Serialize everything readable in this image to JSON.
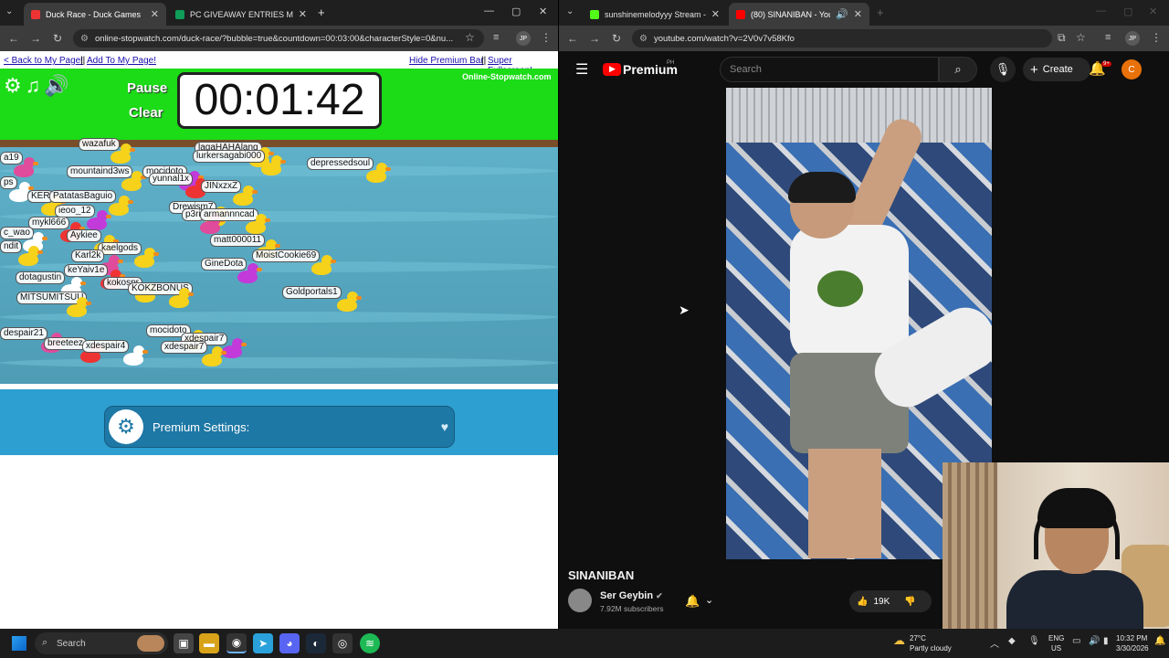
{
  "left_browser": {
    "tabs": [
      {
        "title": "Duck Race - Duck Games",
        "active": true
      },
      {
        "title": "PC GIVEAWAY ENTRIES MAY 20",
        "active": false
      }
    ],
    "url": "online-stopwatch.com/duck-race/?bubble=true&countdown=00:03:00&characterStyle=0&nu...",
    "avatar_initials": "JP"
  },
  "duck_page": {
    "links": {
      "back": "< Back to My Page!",
      "separator": "||",
      "add": "Add To My Page!",
      "hide_premium": "Hide Premium Bar",
      "super_fullscreen": "Super Fullscreen!"
    },
    "controls": {
      "pause": "Pause",
      "clear": "Clear"
    },
    "timer": "00:01:42",
    "brand": "Online-Stopwatch.com",
    "duck_names": [
      "wazafuk",
      "lagaHAHAlang",
      "lurkersagabi000",
      "depressedsoul",
      "a19",
      "mountaind3ws",
      "mocidoto",
      "yunnal1x",
      "ps",
      "KER",
      "PatatasBaguio",
      "JINxzxZ",
      "Drewism7",
      "p3ri",
      "armannncad",
      "ieoo_12",
      "mykl666",
      "c_wao",
      "Aykiee",
      "matt000011",
      "ndit",
      "kaelgods",
      "Karl2k",
      "MoistCookie69",
      "GineDota",
      "keYaiv1e",
      "dotagustin",
      "kokospr",
      "KOKZBONUS",
      "Goldportals1",
      "MITSUMITSUU",
      "despair21",
      "mocidoto",
      "xdespair7",
      "breeteez",
      "xdespair4",
      "xdespair7"
    ],
    "premium_settings": "Premium Settings:"
  },
  "right_browser": {
    "tabs": [
      {
        "title": "sunshinemelodyyy Stream - Wa",
        "active": false
      },
      {
        "title": "(80) SINANIBAN - YouTube",
        "active": true
      }
    ],
    "url": "youtube.com/watch?v=2V0v7v58Kfo",
    "avatar_initials": "JP"
  },
  "youtube": {
    "logo": "Premium",
    "region": "PH",
    "search_placeholder": "Search",
    "create": "Create",
    "notif_badge": "9+",
    "user_initial": "C",
    "video_title": "SINANIBAN",
    "channel": "Ser Geybin",
    "subscribers": "7.92M subscribers",
    "likes": "19K"
  },
  "taskbar": {
    "search": "Search",
    "weather_temp": "27°C",
    "weather_desc": "Partly cloudy",
    "lang_1": "ENG",
    "lang_2": "US",
    "time": "10:32 PM",
    "date": "3/30/2026"
  }
}
